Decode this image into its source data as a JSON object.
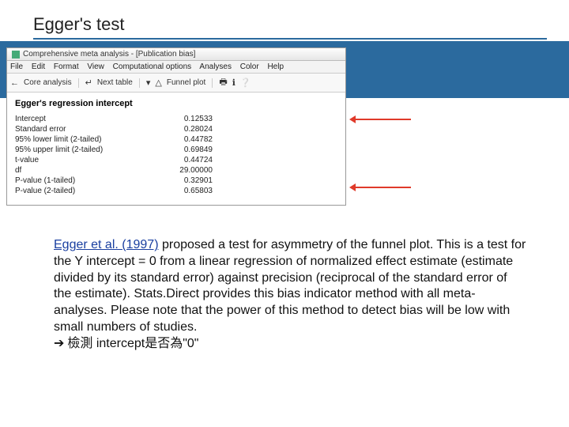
{
  "slide": {
    "title": "Egger's test"
  },
  "app": {
    "window_title": "Comprehensive meta analysis - [Publication bias]",
    "menus": [
      "File",
      "Edit",
      "Format",
      "View",
      "Computational options",
      "Analyses",
      "Color",
      "Help"
    ],
    "toolbar": {
      "core_analysis": "Core analysis",
      "next_table": "Next table",
      "funnel_plot": "Funnel plot"
    },
    "heading": "Egger's regression intercept",
    "rows": [
      {
        "label": "Intercept",
        "value": "0.12533"
      },
      {
        "label": "Standard error",
        "value": "0.28024"
      },
      {
        "label": "95% lower limit (2-tailed)",
        "value": "0.44782"
      },
      {
        "label": "95% upper limit (2-tailed)",
        "value": "0.69849"
      },
      {
        "label": "t-value",
        "value": "0.44724"
      },
      {
        "label": "df",
        "value": "29.00000"
      },
      {
        "label": "P-value (1-tailed)",
        "value": "0.32901"
      },
      {
        "label": "P-value (2-tailed)",
        "value": "0.65803"
      }
    ]
  },
  "body": {
    "link_text": "Egger et al. (1997)",
    "paragraph_rest": " proposed a test for asymmetry of the funnel plot. This is a test for the Y intercept = 0 from a linear regression of normalized effect estimate (estimate divided by its standard error) against precision (reciprocal of the standard error of the estimate). Stats.Direct provides this bias indicator method with all meta-analyses. Please note that the power of this method to detect bias will be low with small numbers of studies.",
    "bullet": "檢測 intercept是否為\"0\""
  }
}
